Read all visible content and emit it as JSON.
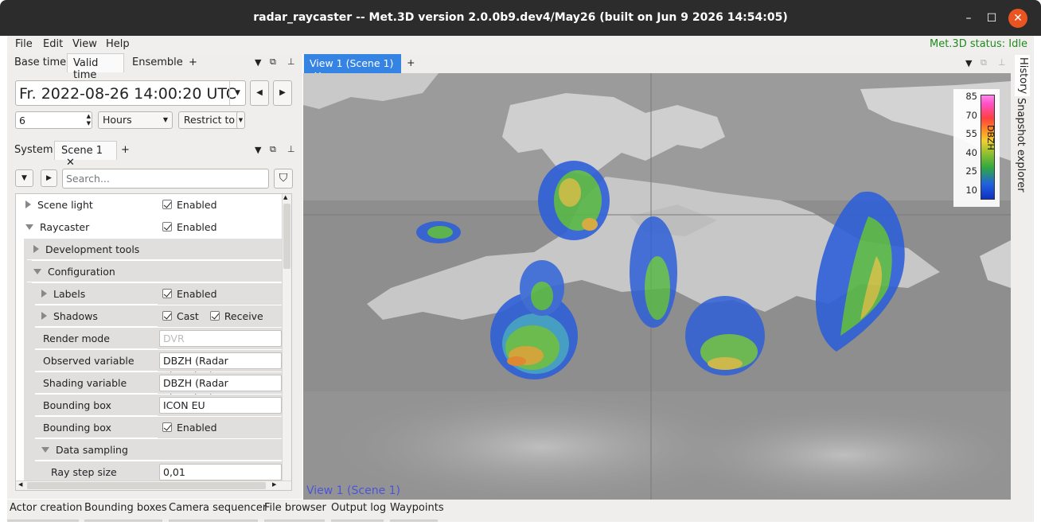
{
  "window": {
    "title": "radar_raycaster -- Met.3D version 2.0.0b9.dev4/May26 (built on Jun  9 2026 14:54:05)"
  },
  "menu": {
    "file": "File",
    "edit": "Edit",
    "view": "View",
    "help": "Help",
    "status": "Met.3D status: Idle"
  },
  "time_tabs": {
    "base": "Base time",
    "valid": "Valid time",
    "ensemble": "Ensemble",
    "add": "+"
  },
  "datetime": {
    "value": "Fr. 2022-08-26 14:00:20 UTC",
    "step_value": "6",
    "step_unit": "Hours",
    "restrict": "Restrict to"
  },
  "scene_tabs": {
    "system": "System",
    "scene": "Scene 1",
    "add": "+"
  },
  "search": {
    "placeholder": "Search..."
  },
  "tree": {
    "scene_light": {
      "label": "Scene light",
      "value": "Enabled"
    },
    "raycaster": {
      "label": "Raycaster",
      "value": "Enabled"
    },
    "dev_tools": {
      "label": "Development tools"
    },
    "configuration": {
      "label": "Configuration"
    },
    "labels": {
      "label": "Labels",
      "value": "Enabled"
    },
    "shadows": {
      "label": "Shadows",
      "cast": "Cast",
      "receive": "Receive"
    },
    "render_mode": {
      "label": "Render mode",
      "value": "DVR"
    },
    "observed_variable": {
      "label": "Observed variable",
      "value": "DBZH (Radar Elevation)"
    },
    "shading_variable": {
      "label": "Shading variable",
      "value": "DBZH (Radar Elevation)"
    },
    "bounding_box": {
      "label": "Bounding box",
      "value": "ICON EU"
    },
    "bounding_box_enabled": {
      "label": "Bounding box",
      "value": "Enabled"
    },
    "data_sampling": {
      "label": "Data sampling"
    },
    "ray_step_size": {
      "label": "Ray step size",
      "value": "0,01"
    }
  },
  "view": {
    "tab": "View 1 (Scene 1)",
    "add": "+",
    "overlay_label": "View 1 (Scene 1)",
    "colorbar": {
      "title": "DBZH",
      "ticks": [
        "85",
        "70",
        "55",
        "40",
        "25",
        "10"
      ]
    }
  },
  "right_dock": {
    "history": "History",
    "snapshot": "Snapshot explorer"
  },
  "bottom_tabs": [
    "Actor creation",
    "Bounding boxes",
    "Camera sequencer",
    "File browser",
    "Output log",
    "Waypoints"
  ],
  "colors": {
    "status": "#1f8a1f",
    "view_tab": "#3584e4",
    "close": "#e95420"
  }
}
